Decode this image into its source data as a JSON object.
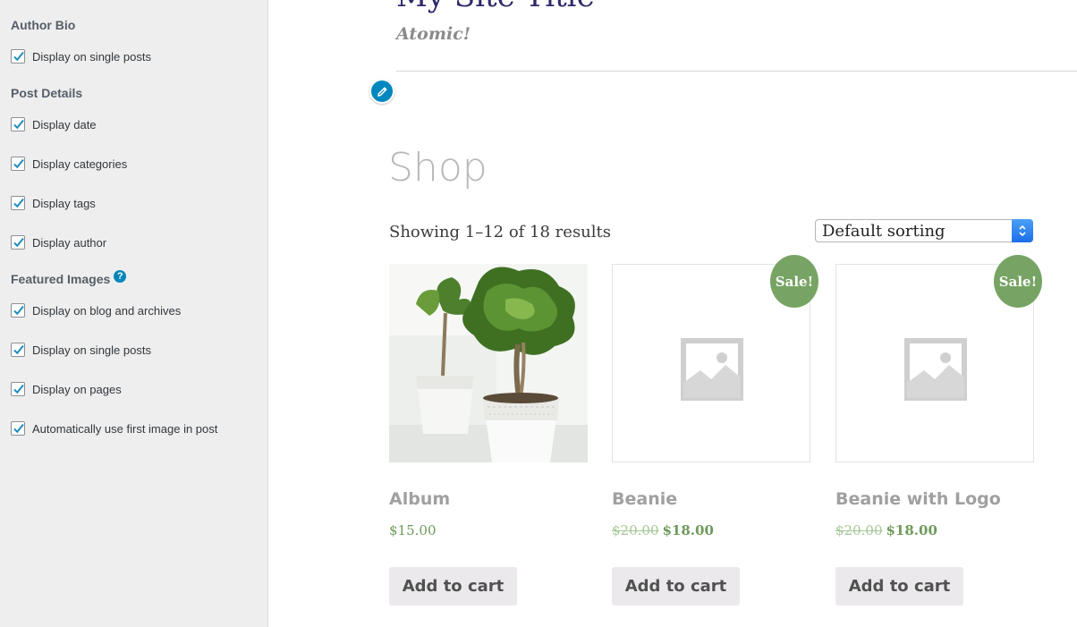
{
  "sidebar": {
    "author_bio": {
      "title": "Author Bio",
      "options": [
        {
          "label": "Display on single posts",
          "checked": true
        }
      ]
    },
    "post_details": {
      "title": "Post Details",
      "options": [
        {
          "label": "Display date",
          "checked": true
        },
        {
          "label": "Display categories",
          "checked": true
        },
        {
          "label": "Display tags",
          "checked": true
        },
        {
          "label": "Display author",
          "checked": true
        }
      ]
    },
    "featured_images": {
      "title": "Featured Images",
      "help_icon": "?",
      "options": [
        {
          "label": "Display on blog and archives",
          "checked": true
        },
        {
          "label": "Display on single posts",
          "checked": true
        },
        {
          "label": "Display on pages",
          "checked": true
        },
        {
          "label": "Automatically use first image in post",
          "checked": true
        }
      ]
    }
  },
  "preview": {
    "site_title": "My Site Title",
    "tagline": "Atomic!",
    "edit_icon": "pencil-icon",
    "page_title": "Shop",
    "result_count": "Showing 1–12 of 18 results",
    "sorting": {
      "selected": "Default sorting"
    },
    "products": [
      {
        "name": "Album",
        "price": "$15.00",
        "old_price": "",
        "on_sale": false,
        "image": "bonsai-plant-photo",
        "button": "Add to cart"
      },
      {
        "name": "Beanie",
        "price": "$18.00",
        "old_price": "$20.00",
        "on_sale": true,
        "sale_label": "Sale!",
        "image": "placeholder-image-icon",
        "button": "Add to cart"
      },
      {
        "name": "Beanie with Logo",
        "price": "$18.00",
        "old_price": "$20.00",
        "on_sale": true,
        "sale_label": "Sale!",
        "image": "placeholder-image-icon",
        "button": "Add to cart"
      }
    ]
  },
  "colors": {
    "accent": "#0085ba",
    "sale_badge": "#77a464",
    "price": "#6f9a5b",
    "site_title": "#2d2a6b"
  }
}
